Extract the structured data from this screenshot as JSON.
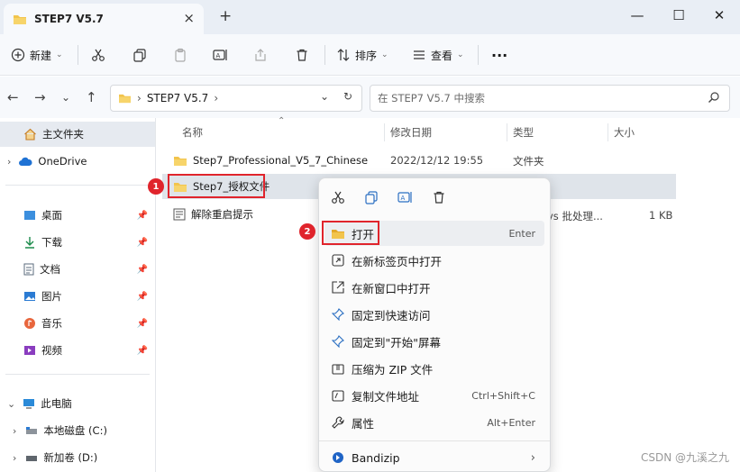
{
  "window": {
    "tab_title": "STEP7 V5.7",
    "close": "×",
    "new_tab": "+",
    "minimize": "—",
    "maximize": "☐",
    "close_window": "✕"
  },
  "toolbar": {
    "new_label": "新建",
    "sort_label": "排序",
    "view_label": "查看",
    "more": "···"
  },
  "nav": {
    "path_folder": "STEP7 V5.7",
    "search_placeholder": "在 STEP7 V5.7 中搜索"
  },
  "sidebar": {
    "items": [
      {
        "label": "主文件夹"
      },
      {
        "label": "OneDrive"
      },
      {
        "label": "桌面"
      },
      {
        "label": "下载"
      },
      {
        "label": "文档"
      },
      {
        "label": "图片"
      },
      {
        "label": "音乐"
      },
      {
        "label": "视频"
      },
      {
        "label": "此电脑"
      },
      {
        "label": "本地磁盘 (C:)"
      },
      {
        "label": "新加卷 (D:)"
      }
    ]
  },
  "columns": {
    "name": "名称",
    "modified": "修改日期",
    "type": "类型",
    "size": "大小"
  },
  "files": [
    {
      "name": "Step7_Professional_V5_7_Chinese",
      "modified": "2022/12/12 19:55",
      "type": "文件夹",
      "size": ""
    },
    {
      "name": "Step7_授权文件",
      "modified": "",
      "type": "",
      "size": ""
    },
    {
      "name": "解除重启提示",
      "modified": "",
      "type": "vs 批处理...",
      "size": "1 KB"
    }
  ],
  "badges": {
    "one": "1",
    "two": "2"
  },
  "context_menu": {
    "items": [
      {
        "label": "打开",
        "shortcut": "Enter"
      },
      {
        "label": "在新标签页中打开",
        "shortcut": ""
      },
      {
        "label": "在新窗口中打开",
        "shortcut": ""
      },
      {
        "label": "固定到快速访问",
        "shortcut": ""
      },
      {
        "label": "固定到\"开始\"屏幕",
        "shortcut": ""
      },
      {
        "label": "压缩为 ZIP 文件",
        "shortcut": ""
      },
      {
        "label": "复制文件地址",
        "shortcut": "Ctrl+Shift+C"
      },
      {
        "label": "属性",
        "shortcut": "Alt+Enter"
      },
      {
        "label": "Bandizip",
        "shortcut": ""
      }
    ]
  },
  "watermark": "CSDN @九溪之九",
  "colors": {
    "accent_red": "#e0242c",
    "folder": "#f2c44c"
  }
}
